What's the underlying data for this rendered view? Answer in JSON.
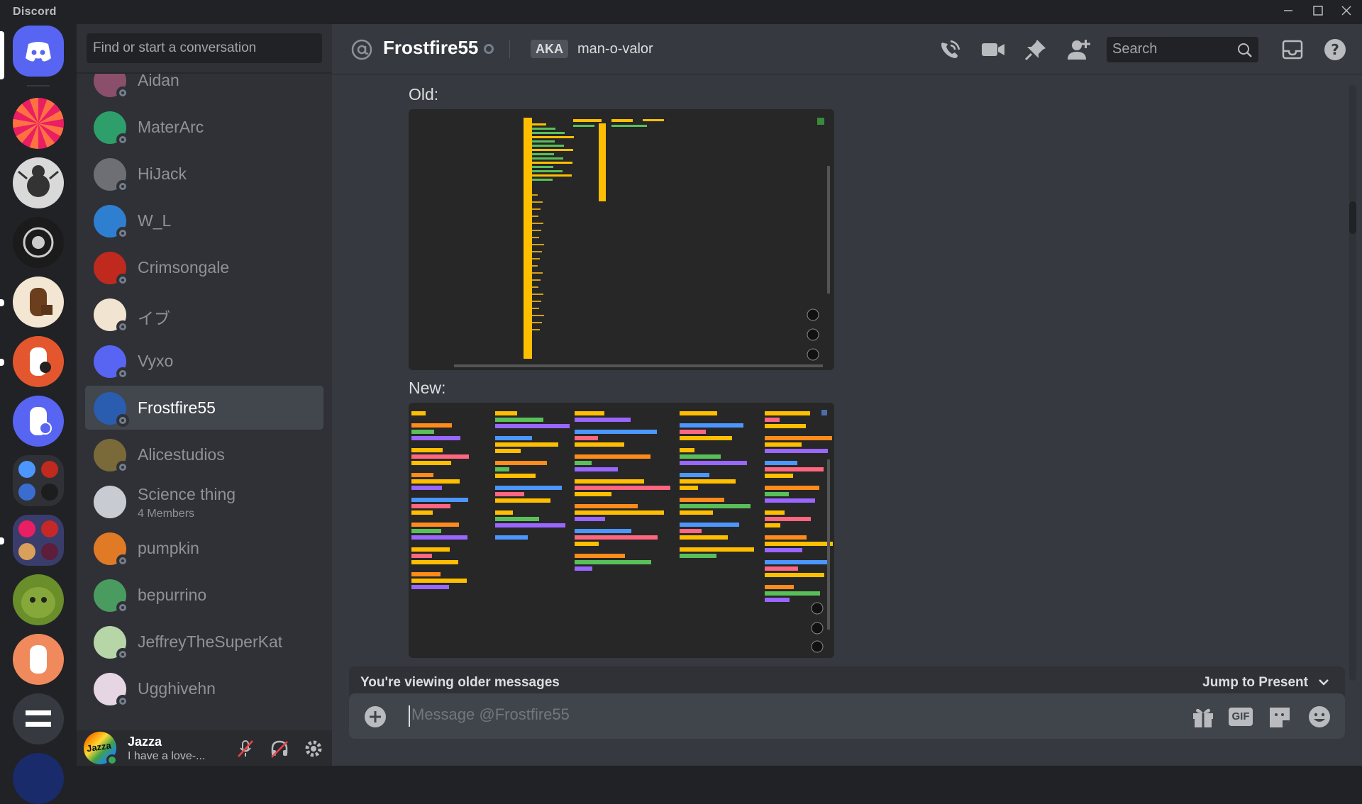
{
  "window": {
    "title": "Discord"
  },
  "dm_search": {
    "placeholder": "Find or start a conversation"
  },
  "dm_list": [
    {
      "name": "Aidan",
      "subtitle": "",
      "selected": false,
      "avatar_color": "#8a4f6a"
    },
    {
      "name": "MaterArc",
      "subtitle": "",
      "selected": false,
      "avatar_color": "#2e9e6b"
    },
    {
      "name": "HiJack",
      "subtitle": "",
      "selected": false,
      "avatar_color": "#6d6f74"
    },
    {
      "name": "W_L",
      "subtitle": "",
      "selected": false,
      "avatar_color": "#2f7fd1"
    },
    {
      "name": "Crimsongale",
      "subtitle": "",
      "selected": false,
      "avatar_color": "#c0291e"
    },
    {
      "name": "イブ",
      "subtitle": "",
      "selected": false,
      "avatar_color": "#f1e4d0"
    },
    {
      "name": "Vyxo",
      "subtitle": "",
      "selected": false,
      "avatar_color": "#5865f2"
    },
    {
      "name": "Frostfire55",
      "subtitle": "",
      "selected": true,
      "avatar_color": "#2a5db0"
    },
    {
      "name": "Alicestudios",
      "subtitle": "",
      "selected": false,
      "avatar_color": "#7a6a3a"
    },
    {
      "name": "Science thing",
      "subtitle": "4 Members",
      "selected": false,
      "avatar_color": "#c8ccd2"
    },
    {
      "name": "pumpkin",
      "subtitle": "",
      "selected": false,
      "avatar_color": "#e07a25"
    },
    {
      "name": "bepurrino",
      "subtitle": "",
      "selected": false,
      "avatar_color": "#4a9b5f"
    },
    {
      "name": "JeffreyTheSuperKat",
      "subtitle": "",
      "selected": false,
      "avatar_color": "#b7d6a8"
    },
    {
      "name": "Ugghivehn",
      "subtitle": "",
      "selected": false,
      "avatar_color": "#e6d6e4"
    }
  ],
  "user_panel": {
    "name": "Jazza",
    "status": "I have a love-...",
    "avatar_text": "Jazza"
  },
  "header": {
    "name": "Frostfire55",
    "aka_label": "AKA",
    "alias": "man-o-valor",
    "search_placeholder": "Search"
  },
  "messages": [
    {
      "label": "Old:"
    },
    {
      "label": "New:"
    }
  ],
  "older_bar": {
    "text": "You're viewing older messages",
    "jump": "Jump to Present"
  },
  "composer": {
    "placeholder": "Message @Frostfire55",
    "gif_label": "GIF"
  },
  "colors": {
    "accent": "#5865f2",
    "online": "#3ba55c",
    "offline": "#747f8d",
    "block_yellow": "#ffbf00",
    "block_orange": "#ff8c1a",
    "block_green": "#59c059",
    "block_purple": "#9966ff",
    "block_blue": "#4c97ff",
    "block_pink": "#ff6680"
  }
}
